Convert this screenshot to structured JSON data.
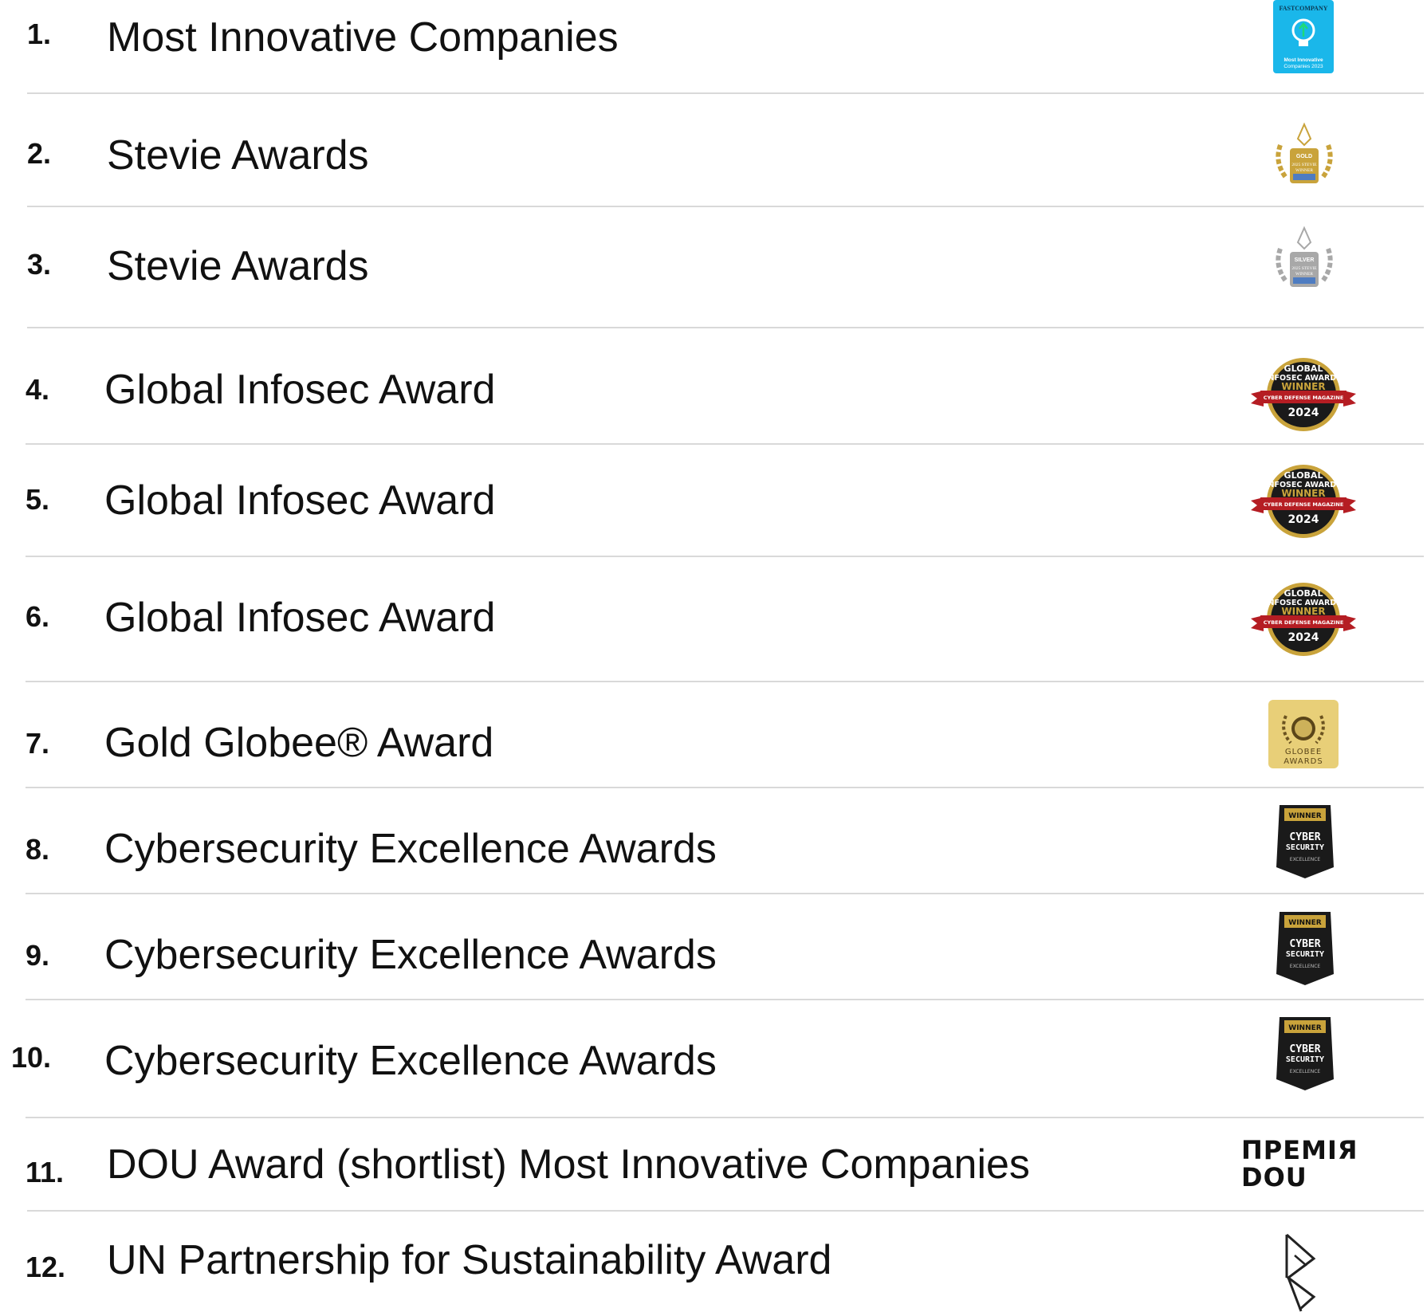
{
  "awards": [
    {
      "num": "1.",
      "title": "Most Innovative Companies",
      "badge": "fast-company-badge",
      "badge_text": {
        "top": "FASTCOMPANY",
        "line1": "Most Innovative",
        "line2": "Companies 2023"
      }
    },
    {
      "num": "2.",
      "title": "Stevie Awards",
      "badge": "stevie-gold-badge",
      "badge_text": {
        "tier": "GOLD",
        "line1": "2025 STEVIE",
        "line2": "WINNER"
      }
    },
    {
      "num": "3.",
      "title": "Stevie Awards",
      "badge": "stevie-silver-badge",
      "badge_text": {
        "tier": "SILVER",
        "line1": "2025 STEVIE",
        "line2": "WINNER"
      }
    },
    {
      "num": "4.",
      "title": "Global Infosec Award",
      "badge": "global-infosec-badge",
      "badge_text": {
        "l1": "GLOBAL",
        "l2": "INFOSEC AWARDS",
        "l3": "WINNER",
        "l4": "CYBER DEFENSE MAGAZINE",
        "year": "2024"
      }
    },
    {
      "num": "5.",
      "title": "Global Infosec Award",
      "badge": "global-infosec-badge",
      "badge_text": {
        "l1": "GLOBAL",
        "l2": "INFOSEC AWARDS",
        "l3": "WINNER",
        "l4": "CYBER DEFENSE MAGAZINE",
        "year": "2024"
      }
    },
    {
      "num": "6.",
      "title": "Global Infosec Award",
      "badge": "global-infosec-badge",
      "badge_text": {
        "l1": "GLOBAL",
        "l2": "INFOSEC AWARDS",
        "l3": "WINNER",
        "l4": "CYBER DEFENSE MAGAZINE",
        "year": "2024"
      }
    },
    {
      "num": "7.",
      "title": "Gold Globee® Award",
      "badge": "globee-badge",
      "badge_text": {
        "l1": "GLOBEE",
        "l2": "AWARDS"
      }
    },
    {
      "num": "8.",
      "title": "Cybersecurity Excellence Awards",
      "badge": "cyber-excellence-badge",
      "badge_text": {
        "l1": "WINNER",
        "l2": "CYBER",
        "l3": "SECURITY",
        "l4": "EXCELLENCE"
      }
    },
    {
      "num": "9.",
      "title": "Cybersecurity Excellence Awards",
      "badge": "cyber-excellence-badge",
      "badge_text": {
        "l1": "WINNER",
        "l2": "CYBER",
        "l3": "SECURITY",
        "l4": "EXCELLENCE"
      }
    },
    {
      "num": "10.",
      "title": "Cybersecurity Excellence Awards",
      "badge": "cyber-excellence-badge",
      "badge_text": {
        "l1": "WINNER",
        "l2": "CYBER",
        "l3": "SECURITY",
        "l4": "EXCELLENCE"
      }
    },
    {
      "num": "11.",
      "title": "DOU Award (shortlist) Most Innovative Companies",
      "badge": "dou-award-logo",
      "badge_text": {
        "l1": "ПРЕМІЯ",
        "l2": "DOU"
      }
    },
    {
      "num": "12.",
      "title": "UN Partnership for Sustainability Award",
      "badge": "un-partnership-logo",
      "badge_text": {}
    }
  ],
  "colors": {
    "text": "#111111",
    "divider": "#d9d9d9",
    "fastcompany": "#1ab7ea",
    "gold": "#c9a33b",
    "silver": "#a8a8a8",
    "globee": "#e8cf78",
    "dark": "#1a1a1a",
    "red": "#b51d23"
  }
}
